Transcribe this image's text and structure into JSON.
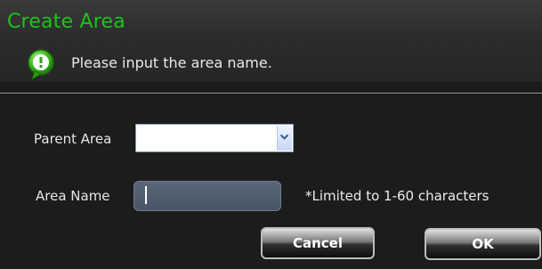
{
  "dialog": {
    "title": "Create Area",
    "hint": "Please input the area name.",
    "hint_icon": "info-bubble-icon"
  },
  "form": {
    "parent_area_label": "Parent Area",
    "parent_area_value": "",
    "area_name_label": "Area Name",
    "area_name_value": "",
    "area_name_hint": "*Limited to 1-60 characters"
  },
  "buttons": {
    "cancel": "Cancel",
    "ok": "OK"
  },
  "colors": {
    "title": "#19c519",
    "background": "#1c1c1c",
    "input_bg": "#485567"
  }
}
